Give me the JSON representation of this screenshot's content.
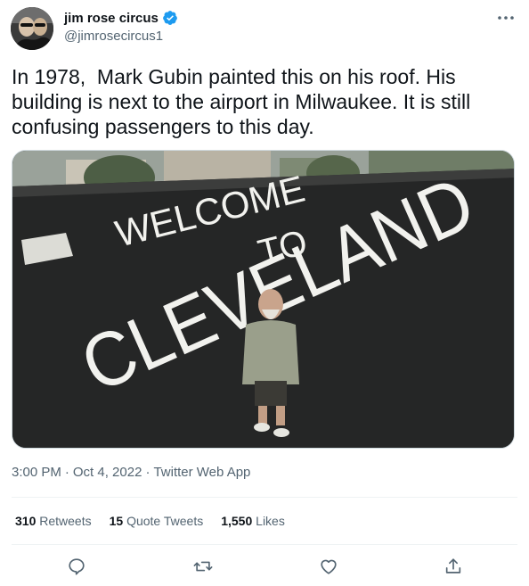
{
  "author": {
    "display_name": "jim rose circus",
    "handle": "@jimrosecircus1",
    "verified": true
  },
  "tweet": {
    "text": "In 1978,  Mark Gubin painted this on his roof. His building is next to the airport in Milwaukee. It is still confusing passengers to this day.",
    "media": {
      "painted_words": [
        "WELCOME",
        "TO",
        "CLEVELAND"
      ]
    }
  },
  "meta": {
    "time": "3:00 PM",
    "sep1": "·",
    "date": "Oct 4, 2022",
    "sep2": "·",
    "source": "Twitter Web App"
  },
  "stats": {
    "retweets_count": "310",
    "retweets_label": "Retweets",
    "quotes_count": "15",
    "quotes_label": "Quote Tweets",
    "likes_count": "1,550",
    "likes_label": "Likes"
  },
  "icons": {
    "verified": "verified-badge-icon",
    "more": "more-icon",
    "reply": "reply-icon",
    "retweet": "retweet-icon",
    "like": "like-icon",
    "share": "share-icon"
  },
  "colors": {
    "text_primary": "#0f1419",
    "text_secondary": "#536471",
    "verified_blue": "#1d9bf0",
    "divider": "#eff3f4"
  }
}
